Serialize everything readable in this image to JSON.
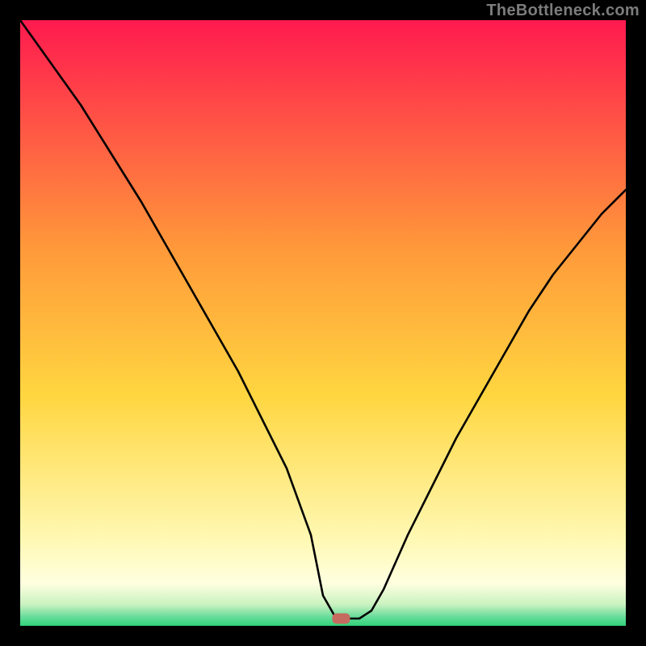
{
  "watermark": "TheBottleneck.com",
  "chart_data": {
    "type": "line",
    "title": "",
    "xlabel": "",
    "ylabel": "",
    "xlim": [
      0,
      100
    ],
    "ylim": [
      0,
      100
    ],
    "grid": false,
    "legend": false,
    "annotations": [],
    "background_gradient": {
      "top_color": "#ff1a4f",
      "mid_color": "#ffd640",
      "lower_color": "#fff9b5",
      "bottom_color": "#2fd37a"
    },
    "marker": {
      "x": 53,
      "y": 1.2,
      "shape": "rounded-square",
      "color": "#c66b5f"
    },
    "series": [
      {
        "name": "curve",
        "x": [
          0,
          5,
          10,
          15,
          20,
          24,
          28,
          32,
          36,
          40,
          44,
          48,
          50,
          52,
          54,
          56,
          58,
          60,
          64,
          68,
          72,
          76,
          80,
          84,
          88,
          92,
          96,
          100
        ],
        "y": [
          100,
          93,
          86,
          78,
          70,
          63,
          56,
          49,
          42,
          34,
          26,
          15,
          5,
          1.5,
          1.2,
          1.2,
          2.5,
          6,
          15,
          23,
          31,
          38,
          45,
          52,
          58,
          63,
          68,
          72
        ]
      }
    ]
  }
}
